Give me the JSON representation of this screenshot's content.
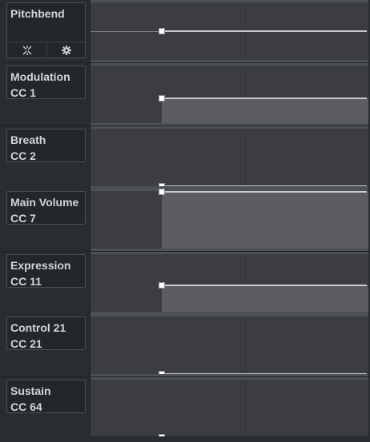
{
  "lanes": [
    {
      "name": "Pitchbend",
      "cc": "",
      "value": 0.5,
      "has_controls": true,
      "controls": [
        {
          "icon": "collapse-icon"
        },
        {
          "icon": "gear-icon"
        }
      ]
    },
    {
      "name": "Modulation",
      "cc": "CC 1",
      "value": 0.43,
      "has_controls": false
    },
    {
      "name": "Breath",
      "cc": "CC 2",
      "value": 0.0,
      "has_controls": false
    },
    {
      "name": "Main Volume",
      "cc": "CC 7",
      "value": 1.0,
      "has_controls": false
    },
    {
      "name": "Expression",
      "cc": "CC 11",
      "value": 0.46,
      "has_controls": false
    },
    {
      "name": "Control 21",
      "cc": "CC 21",
      "value": 0.0,
      "has_controls": false
    },
    {
      "name": "Sustain",
      "cc": "CC 64",
      "value": 0.0,
      "has_controls": false
    }
  ],
  "colors": {
    "header_bg": "#2a2d30",
    "lane_bg": "#3b3d40",
    "value_fill": "#5b5d60",
    "value_line": "#c9cbcd",
    "label_text": "#d2d5d8"
  }
}
